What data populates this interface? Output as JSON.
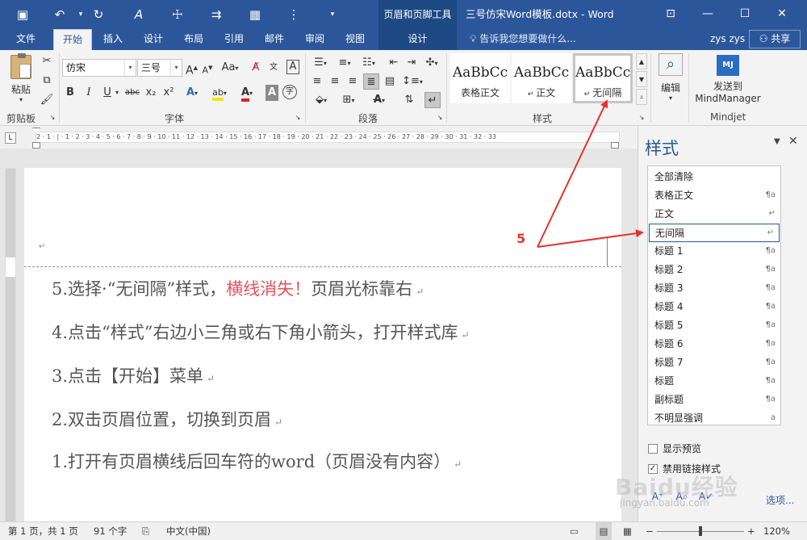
{
  "titlebar": {
    "context_tool": "页眉和页脚工具",
    "doc_title": "三号仿宋Word模板.dotx - Word",
    "qat_icons": [
      "save-icon",
      "undo-icon",
      "redo-icon",
      "format-painter-icon",
      "touch-mode-icon",
      "arrow-icon",
      "table-icon",
      "customize-icon"
    ]
  },
  "tabs": [
    "文件",
    "开始",
    "插入",
    "设计",
    "布局",
    "引用",
    "邮件",
    "审阅",
    "视图",
    "设计"
  ],
  "tell_me": "告诉我您想要做什么...",
  "user": "zys zys",
  "share": "共享",
  "ribbon": {
    "clipboard": {
      "paste": "粘贴",
      "label": "剪贴板"
    },
    "font": {
      "name": "仿宋",
      "size": "三号",
      "label": "字体",
      "grow": "A",
      "shrink": "A",
      "case": "Aa",
      "bold": "B",
      "italic": "I",
      "underline": "U",
      "strike": "abc",
      "sub": "x₂",
      "sup": "x²"
    },
    "paragraph": {
      "label": "段落"
    },
    "styles": {
      "label": "样式",
      "items": [
        {
          "sample": "AaBbCc",
          "name": "表格正文"
        },
        {
          "sample": "AaBbCc",
          "name": "正文"
        },
        {
          "sample": "AaBbCc",
          "name": "无间隔"
        }
      ]
    },
    "editing": {
      "label": "编辑"
    },
    "mindjet": {
      "send": "发送到",
      "target": "MindManager",
      "label": "Mindjet"
    }
  },
  "ruler_marks": "2 · 1 · | · 1 · 2 · 3 · 4 · 5 · 6 · 7 · 8 · 9 · 10 · 11 · 12 · 13 · 14 · 15 · 16 · 17 · 18 · 19 · 20 · 21 · 22 · 23 · 24 · 25 · 26 · 27 · 28 · 29 · 30 · 31 · 32 · 33",
  "document": {
    "lines": [
      {
        "a": "5.选择·“无间隔”样式，",
        "b": "横线消失！",
        "c": "页眉光标靠右"
      },
      {
        "a": "4.点击“样式”右边小三角或右下角小箭头，打开样式库",
        "b": "",
        "c": ""
      },
      {
        "a": "3.点击【开始】菜单",
        "b": "",
        "c": ""
      },
      {
        "a": "2.双击页眉位置，切换到页眉",
        "b": "",
        "c": ""
      },
      {
        "a": "1.打开有页眉横线后回车符的word（页眉没有内容）",
        "b": "",
        "c": ""
      }
    ],
    "para_mark": "↵"
  },
  "annotation": {
    "number": "5",
    "color": "#e8312f"
  },
  "styles_pane": {
    "title": "样式",
    "items": [
      {
        "name": "全部清除",
        "mark": ""
      },
      {
        "name": "表格正文",
        "mark": "¶a"
      },
      {
        "name": "正文",
        "mark": "↵"
      },
      {
        "name": "无间隔",
        "mark": "↵"
      },
      {
        "name": "标题 1",
        "mark": "¶a"
      },
      {
        "name": "标题 2",
        "mark": "¶a"
      },
      {
        "name": "标题 3",
        "mark": "¶a"
      },
      {
        "name": "标题 4",
        "mark": "¶a"
      },
      {
        "name": "标题 5",
        "mark": "¶a"
      },
      {
        "name": "标题 6",
        "mark": "¶a"
      },
      {
        "name": "标题 7",
        "mark": "¶a"
      },
      {
        "name": "标题",
        "mark": "¶a"
      },
      {
        "name": "副标题",
        "mark": "¶a"
      },
      {
        "name": "不明显强调",
        "mark": "a"
      }
    ],
    "selected_index": 3,
    "show_preview": "显示预览",
    "disable_linked": "禁用链接样式",
    "options": "选项..."
  },
  "status": {
    "page": "第 1 页，共 1 页",
    "words": "91 个字",
    "lang": "中文(中国)",
    "zoom": "120%"
  },
  "watermark": {
    "text": "Baidu经验",
    "url": "jingyan.baidu.com"
  },
  "colors": {
    "accent": "#2b579a",
    "annotation_red": "#e8312f",
    "doc_red": "#e8525a"
  }
}
